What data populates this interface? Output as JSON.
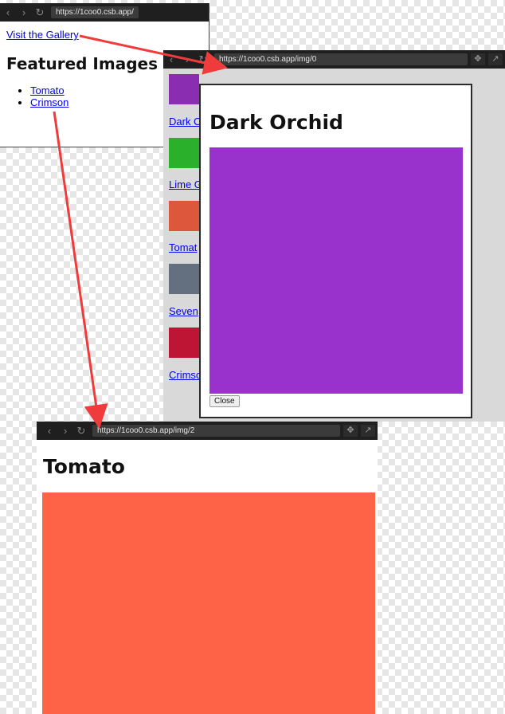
{
  "window1": {
    "url": "https://1coo0.csb.app/",
    "visit_link": "Visit the Gallery",
    "heading": "Featured Images",
    "list": [
      "Tomato",
      "Crimson"
    ]
  },
  "window2": {
    "url": "https://1coo0.csb.app/img/0",
    "side_links": [
      "Dark C",
      "Lime G",
      "Tomat",
      "Seven",
      "Crimso"
    ],
    "thumb_colors": [
      "#8a2db0",
      "#2bb02b",
      "#dd573d",
      "#647080",
      "#be1535"
    ],
    "modal_title": "Dark Orchid",
    "modal_color": "#9932cc",
    "close_label": "Close"
  },
  "window3": {
    "url": "https://1coo0.csb.app/img/2",
    "heading": "Tomato",
    "color": "#ff6347"
  },
  "arrow_color": "#ef3b3b"
}
